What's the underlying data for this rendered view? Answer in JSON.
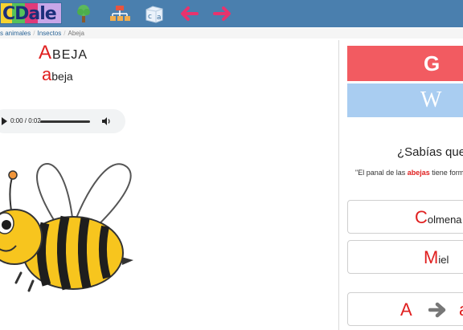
{
  "header": {
    "logo_text": "CDale",
    "tools": [
      {
        "icon": "tree-icon"
      },
      {
        "icon": "sitemap-icon"
      },
      {
        "icon": "letter-blocks-icon"
      },
      {
        "icon": "arrow-left-icon"
      },
      {
        "icon": "arrow-right-icon"
      }
    ]
  },
  "breadcrumb": {
    "items": [
      "s animales",
      "Insectos",
      "Abeja"
    ],
    "separator": "/"
  },
  "word": {
    "upper_initial": "A",
    "upper_rest": "BEJA",
    "lower_initial": "a",
    "lower_rest": "beja"
  },
  "audio": {
    "time": "0:00 / 0:02"
  },
  "image": {
    "icon": "bee-illustration"
  },
  "search": {
    "google_label": "G",
    "wiki_label": "W"
  },
  "did_you_know": {
    "title": "¿Sabías que...",
    "fact_before": "\"El panal de las ",
    "fact_highlight": "abejas",
    "fact_after": " tiene form"
  },
  "related_words": [
    {
      "initial": "C",
      "rest": "olmena"
    },
    {
      "initial": "M",
      "rest": "iel"
    }
  ],
  "case_toggle": {
    "upper": "A",
    "lower": "a"
  },
  "colors": {
    "header_bg": "#4a7fae",
    "google": "#f25b61",
    "wiki": "#a9cdf1",
    "accent_red": "#e02020"
  }
}
